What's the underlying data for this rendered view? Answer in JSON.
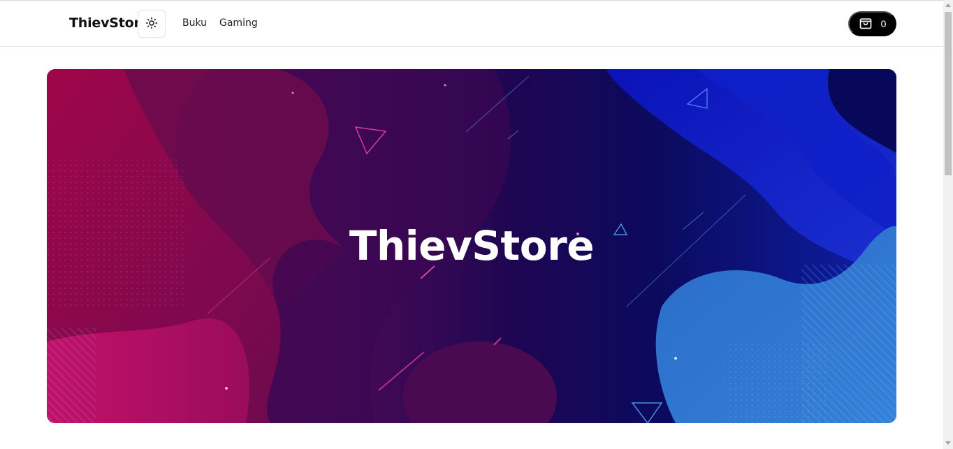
{
  "navbar": {
    "brand": "ThievStore",
    "theme_toggle_icon": "sun-icon",
    "links": [
      "Buku",
      "Gaming"
    ],
    "cart": {
      "icon": "shopping-bag-icon",
      "count": "0"
    }
  },
  "hero": {
    "title": "ThievStore",
    "background": "abstract-fluid-gradient-image"
  },
  "colors": {
    "cart_bg": "#000000",
    "hero_pink": "#a5105a",
    "hero_purple": "#2a0650",
    "hero_blue": "#1326c4",
    "hero_light_blue": "#2f74d0"
  }
}
